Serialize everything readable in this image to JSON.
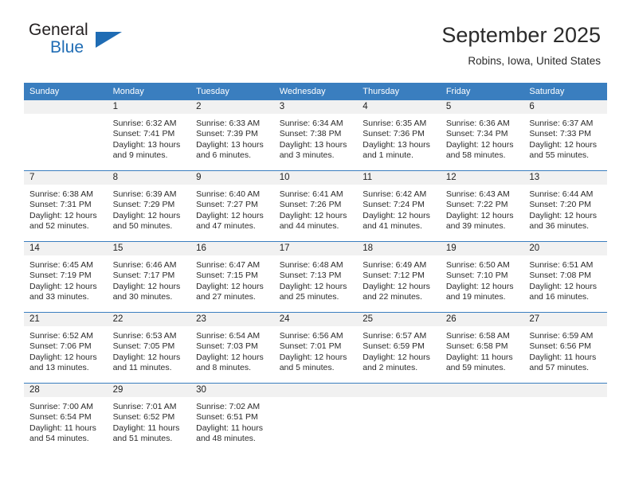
{
  "brand": {
    "name_part1": "General",
    "name_part2": "Blue"
  },
  "header": {
    "title": "September 2025",
    "subtitle": "Robins, Iowa, United States"
  },
  "weekday_headers": [
    "Sunday",
    "Monday",
    "Tuesday",
    "Wednesday",
    "Thursday",
    "Friday",
    "Saturday"
  ],
  "colors": {
    "header_blue": "#3a7ebf",
    "daynum_band": "#f1f1f1",
    "brand_blue": "#1f6cb4",
    "text": "#2b2b2b"
  },
  "labels": {
    "sunrise_prefix": "Sunrise: ",
    "sunset_prefix": "Sunset: ",
    "daylight_prefix": "Daylight: "
  },
  "weeks": [
    [
      {
        "day": "",
        "empty": true
      },
      {
        "day": "1",
        "sunrise": "Sunrise: 6:32 AM",
        "sunset": "Sunset: 7:41 PM",
        "daylight1": "Daylight: 13 hours",
        "daylight2": "and 9 minutes."
      },
      {
        "day": "2",
        "sunrise": "Sunrise: 6:33 AM",
        "sunset": "Sunset: 7:39 PM",
        "daylight1": "Daylight: 13 hours",
        "daylight2": "and 6 minutes."
      },
      {
        "day": "3",
        "sunrise": "Sunrise: 6:34 AM",
        "sunset": "Sunset: 7:38 PM",
        "daylight1": "Daylight: 13 hours",
        "daylight2": "and 3 minutes."
      },
      {
        "day": "4",
        "sunrise": "Sunrise: 6:35 AM",
        "sunset": "Sunset: 7:36 PM",
        "daylight1": "Daylight: 13 hours",
        "daylight2": "and 1 minute."
      },
      {
        "day": "5",
        "sunrise": "Sunrise: 6:36 AM",
        "sunset": "Sunset: 7:34 PM",
        "daylight1": "Daylight: 12 hours",
        "daylight2": "and 58 minutes."
      },
      {
        "day": "6",
        "sunrise": "Sunrise: 6:37 AM",
        "sunset": "Sunset: 7:33 PM",
        "daylight1": "Daylight: 12 hours",
        "daylight2": "and 55 minutes."
      }
    ],
    [
      {
        "day": "7",
        "sunrise": "Sunrise: 6:38 AM",
        "sunset": "Sunset: 7:31 PM",
        "daylight1": "Daylight: 12 hours",
        "daylight2": "and 52 minutes."
      },
      {
        "day": "8",
        "sunrise": "Sunrise: 6:39 AM",
        "sunset": "Sunset: 7:29 PM",
        "daylight1": "Daylight: 12 hours",
        "daylight2": "and 50 minutes."
      },
      {
        "day": "9",
        "sunrise": "Sunrise: 6:40 AM",
        "sunset": "Sunset: 7:27 PM",
        "daylight1": "Daylight: 12 hours",
        "daylight2": "and 47 minutes."
      },
      {
        "day": "10",
        "sunrise": "Sunrise: 6:41 AM",
        "sunset": "Sunset: 7:26 PM",
        "daylight1": "Daylight: 12 hours",
        "daylight2": "and 44 minutes."
      },
      {
        "day": "11",
        "sunrise": "Sunrise: 6:42 AM",
        "sunset": "Sunset: 7:24 PM",
        "daylight1": "Daylight: 12 hours",
        "daylight2": "and 41 minutes."
      },
      {
        "day": "12",
        "sunrise": "Sunrise: 6:43 AM",
        "sunset": "Sunset: 7:22 PM",
        "daylight1": "Daylight: 12 hours",
        "daylight2": "and 39 minutes."
      },
      {
        "day": "13",
        "sunrise": "Sunrise: 6:44 AM",
        "sunset": "Sunset: 7:20 PM",
        "daylight1": "Daylight: 12 hours",
        "daylight2": "and 36 minutes."
      }
    ],
    [
      {
        "day": "14",
        "sunrise": "Sunrise: 6:45 AM",
        "sunset": "Sunset: 7:19 PM",
        "daylight1": "Daylight: 12 hours",
        "daylight2": "and 33 minutes."
      },
      {
        "day": "15",
        "sunrise": "Sunrise: 6:46 AM",
        "sunset": "Sunset: 7:17 PM",
        "daylight1": "Daylight: 12 hours",
        "daylight2": "and 30 minutes."
      },
      {
        "day": "16",
        "sunrise": "Sunrise: 6:47 AM",
        "sunset": "Sunset: 7:15 PM",
        "daylight1": "Daylight: 12 hours",
        "daylight2": "and 27 minutes."
      },
      {
        "day": "17",
        "sunrise": "Sunrise: 6:48 AM",
        "sunset": "Sunset: 7:13 PM",
        "daylight1": "Daylight: 12 hours",
        "daylight2": "and 25 minutes."
      },
      {
        "day": "18",
        "sunrise": "Sunrise: 6:49 AM",
        "sunset": "Sunset: 7:12 PM",
        "daylight1": "Daylight: 12 hours",
        "daylight2": "and 22 minutes."
      },
      {
        "day": "19",
        "sunrise": "Sunrise: 6:50 AM",
        "sunset": "Sunset: 7:10 PM",
        "daylight1": "Daylight: 12 hours",
        "daylight2": "and 19 minutes."
      },
      {
        "day": "20",
        "sunrise": "Sunrise: 6:51 AM",
        "sunset": "Sunset: 7:08 PM",
        "daylight1": "Daylight: 12 hours",
        "daylight2": "and 16 minutes."
      }
    ],
    [
      {
        "day": "21",
        "sunrise": "Sunrise: 6:52 AM",
        "sunset": "Sunset: 7:06 PM",
        "daylight1": "Daylight: 12 hours",
        "daylight2": "and 13 minutes."
      },
      {
        "day": "22",
        "sunrise": "Sunrise: 6:53 AM",
        "sunset": "Sunset: 7:05 PM",
        "daylight1": "Daylight: 12 hours",
        "daylight2": "and 11 minutes."
      },
      {
        "day": "23",
        "sunrise": "Sunrise: 6:54 AM",
        "sunset": "Sunset: 7:03 PM",
        "daylight1": "Daylight: 12 hours",
        "daylight2": "and 8 minutes."
      },
      {
        "day": "24",
        "sunrise": "Sunrise: 6:56 AM",
        "sunset": "Sunset: 7:01 PM",
        "daylight1": "Daylight: 12 hours",
        "daylight2": "and 5 minutes."
      },
      {
        "day": "25",
        "sunrise": "Sunrise: 6:57 AM",
        "sunset": "Sunset: 6:59 PM",
        "daylight1": "Daylight: 12 hours",
        "daylight2": "and 2 minutes."
      },
      {
        "day": "26",
        "sunrise": "Sunrise: 6:58 AM",
        "sunset": "Sunset: 6:58 PM",
        "daylight1": "Daylight: 11 hours",
        "daylight2": "and 59 minutes."
      },
      {
        "day": "27",
        "sunrise": "Sunrise: 6:59 AM",
        "sunset": "Sunset: 6:56 PM",
        "daylight1": "Daylight: 11 hours",
        "daylight2": "and 57 minutes."
      }
    ],
    [
      {
        "day": "28",
        "sunrise": "Sunrise: 7:00 AM",
        "sunset": "Sunset: 6:54 PM",
        "daylight1": "Daylight: 11 hours",
        "daylight2": "and 54 minutes."
      },
      {
        "day": "29",
        "sunrise": "Sunrise: 7:01 AM",
        "sunset": "Sunset: 6:52 PM",
        "daylight1": "Daylight: 11 hours",
        "daylight2": "and 51 minutes."
      },
      {
        "day": "30",
        "sunrise": "Sunrise: 7:02 AM",
        "sunset": "Sunset: 6:51 PM",
        "daylight1": "Daylight: 11 hours",
        "daylight2": "and 48 minutes."
      },
      {
        "day": "",
        "empty": true
      },
      {
        "day": "",
        "empty": true
      },
      {
        "day": "",
        "empty": true
      },
      {
        "day": "",
        "empty": true
      }
    ]
  ]
}
